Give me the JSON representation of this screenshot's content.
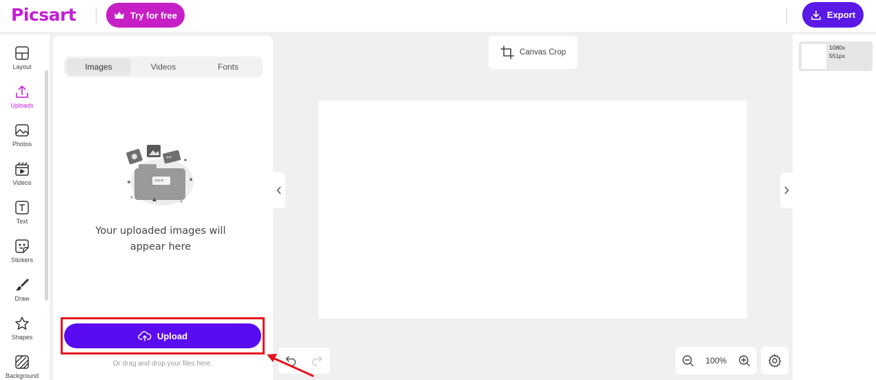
{
  "header": {
    "logo_text": "Picsart",
    "try_label": "Try for free",
    "export_label": "Export"
  },
  "sidebar": {
    "items": [
      {
        "label": "Layout",
        "icon": "layout-icon"
      },
      {
        "label": "Uploads",
        "icon": "upload-icon",
        "active": true
      },
      {
        "label": "Photos",
        "icon": "photo-icon"
      },
      {
        "label": "Videos",
        "icon": "video-icon"
      },
      {
        "label": "Text",
        "icon": "text-icon"
      },
      {
        "label": "Stickers",
        "icon": "sticker-icon"
      },
      {
        "label": "Draw",
        "icon": "brush-icon"
      },
      {
        "label": "Shapes",
        "icon": "star-icon"
      },
      {
        "label": "Background",
        "icon": "background-icon"
      }
    ]
  },
  "uploads_panel": {
    "tabs": [
      "Images",
      "Videos",
      "Fonts"
    ],
    "selected_tab": "Images",
    "empty_line1": "Your uploaded images will",
    "empty_line2": "appear here",
    "upload_label": "Upload",
    "hint": "Or drag and drop your files here."
  },
  "canvas": {
    "crop_label": "Canvas Crop",
    "zoom": "100%"
  },
  "pages": {
    "width_label": "1080x",
    "height_label": "551px"
  },
  "colors": {
    "brand": "#c41ed6",
    "primary": "#5a0cf0",
    "highlight": "#e3141e"
  }
}
